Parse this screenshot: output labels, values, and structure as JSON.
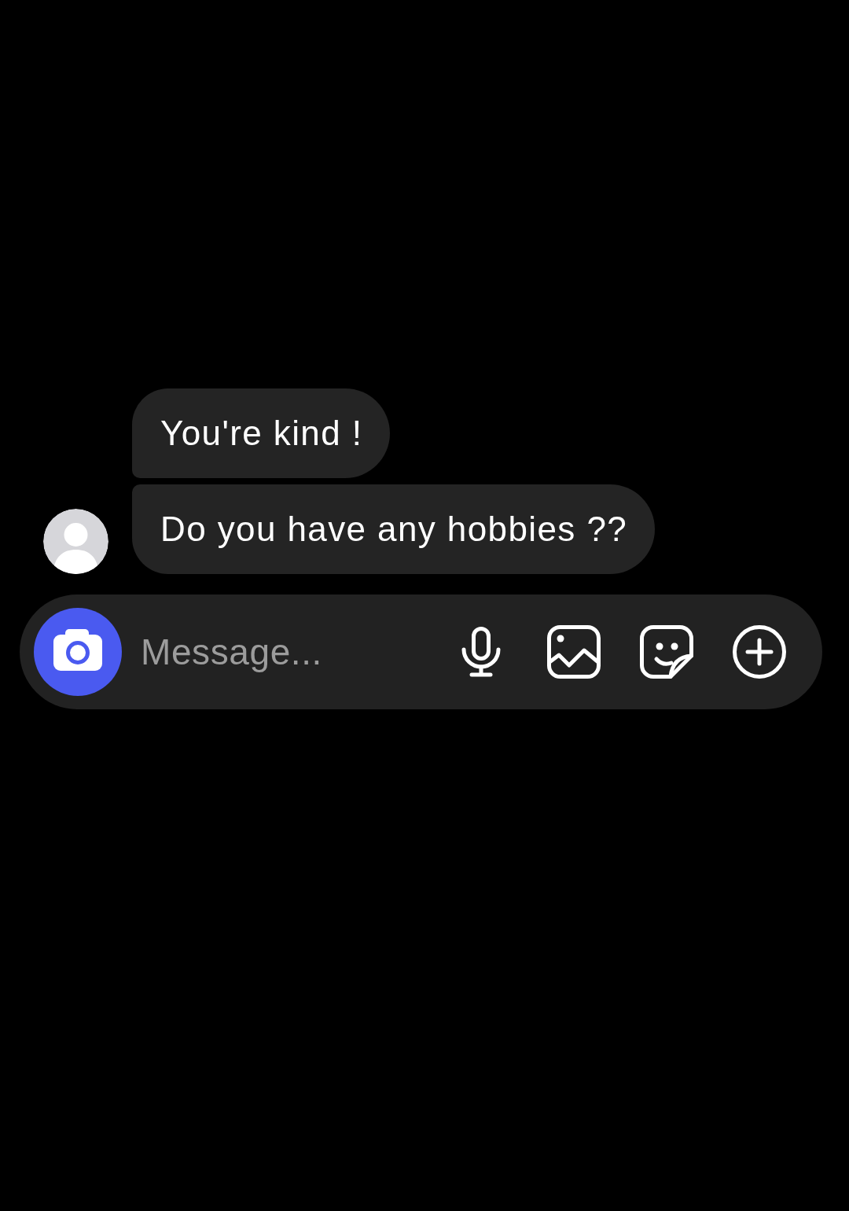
{
  "messages": [
    {
      "text": "You're kind !"
    },
    {
      "text": "Do you have any hobbies ??"
    }
  ],
  "composer": {
    "placeholder": "Message..."
  }
}
